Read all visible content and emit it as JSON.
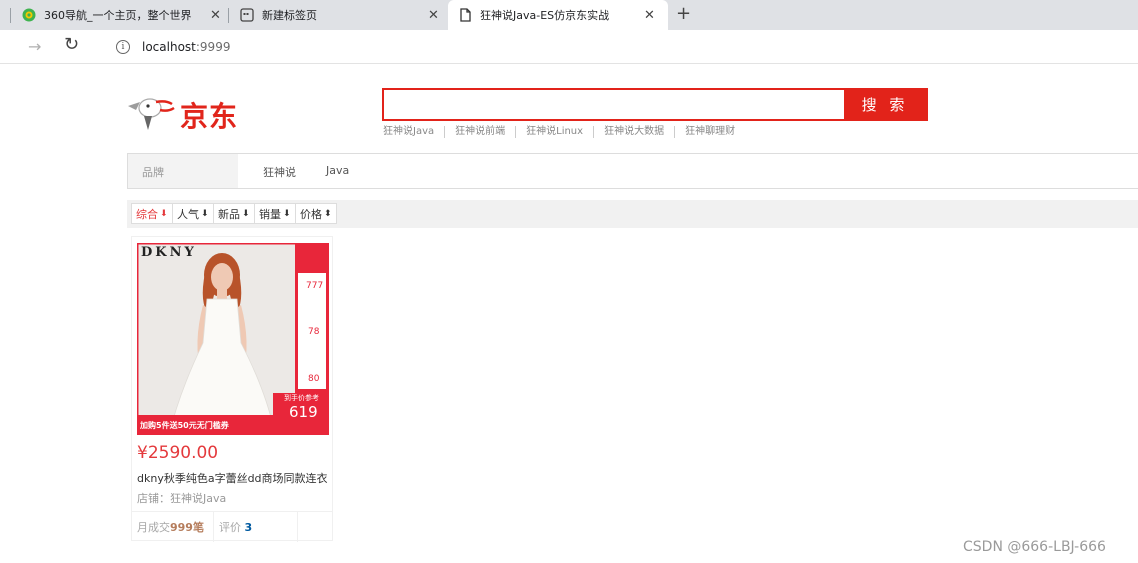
{
  "browser": {
    "tabs": [
      {
        "title": "360导航_一个主页，整个世界",
        "icon": "360-browser-icon"
      },
      {
        "title": "新建标签页",
        "icon": "new-tab-page-icon"
      },
      {
        "title": "狂神说Java-ES仿京东实战",
        "icon": "document-icon",
        "active": true
      }
    ],
    "url_host": "localhost",
    "url_port": ":9999"
  },
  "header": {
    "logo_text": "京东",
    "search_placeholder": "",
    "search_button": "搜 索",
    "hotwords": [
      "狂神说Java",
      "狂神说前端",
      "狂神说Linux",
      "狂神说大数据",
      "狂神聊理财"
    ]
  },
  "brand": {
    "label": "品牌",
    "values": [
      "狂神说",
      "Java"
    ]
  },
  "sorts": [
    {
      "label": "综合",
      "icon": "sort-down-icon",
      "active": true
    },
    {
      "label": "人气",
      "icon": "sort-down-icon"
    },
    {
      "label": "新品",
      "icon": "sort-down-icon"
    },
    {
      "label": "销量",
      "icon": "sort-down-icon"
    },
    {
      "label": "价格",
      "icon": "sort-updown-icon"
    }
  ],
  "product": {
    "image_brand": "DKNY",
    "price": "¥2590.00",
    "title": "dkny秋季纯色a字蕾丝dd商场同款连衣",
    "shop_label": "店铺：",
    "shop_name": "狂神说Java",
    "monthly_label": "月成交",
    "monthly_value": "999笔",
    "review_label": "评价",
    "review_value": "3",
    "promo": {
      "price1": "777",
      "price2": "78",
      "price3": "80",
      "final_label": "到手价参考",
      "final_price": "619",
      "banner": "加购5件送50元无门槛券"
    }
  },
  "watermark": "CSDN @666-LBJ-666",
  "colors": {
    "accent": "#e2231a",
    "price": "#e4393c"
  }
}
